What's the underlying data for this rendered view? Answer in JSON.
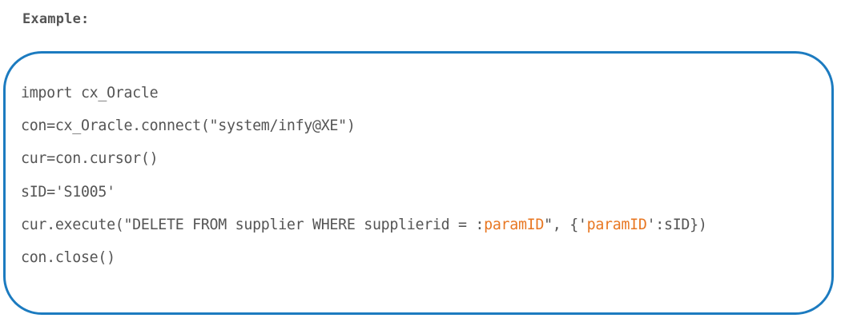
{
  "heading": "Example:",
  "colors": {
    "text": "#555555",
    "highlight": "#e87722",
    "border": "#1c7bc0"
  },
  "code": {
    "lines": [
      {
        "segments": [
          {
            "text": "import cx_Oracle",
            "style": "plain"
          }
        ]
      },
      {
        "segments": [
          {
            "text": "con=cx_Oracle.connect(\"system/infy@XE\")",
            "style": "plain"
          }
        ]
      },
      {
        "segments": [
          {
            "text": "cur=con.cursor()",
            "style": "plain"
          }
        ]
      },
      {
        "segments": [
          {
            "text": "sID='S1005'",
            "style": "plain"
          }
        ]
      },
      {
        "segments": [
          {
            "text": "cur.execute(\"DELETE FROM supplier WHERE supplierid = :",
            "style": "plain"
          },
          {
            "text": "paramID",
            "style": "highlight"
          },
          {
            "text": "\", {'",
            "style": "plain"
          },
          {
            "text": "paramID",
            "style": "highlight"
          },
          {
            "text": "':sID})",
            "style": "plain"
          }
        ]
      },
      {
        "segments": [
          {
            "text": "con.close()",
            "style": "plain"
          }
        ]
      }
    ]
  }
}
